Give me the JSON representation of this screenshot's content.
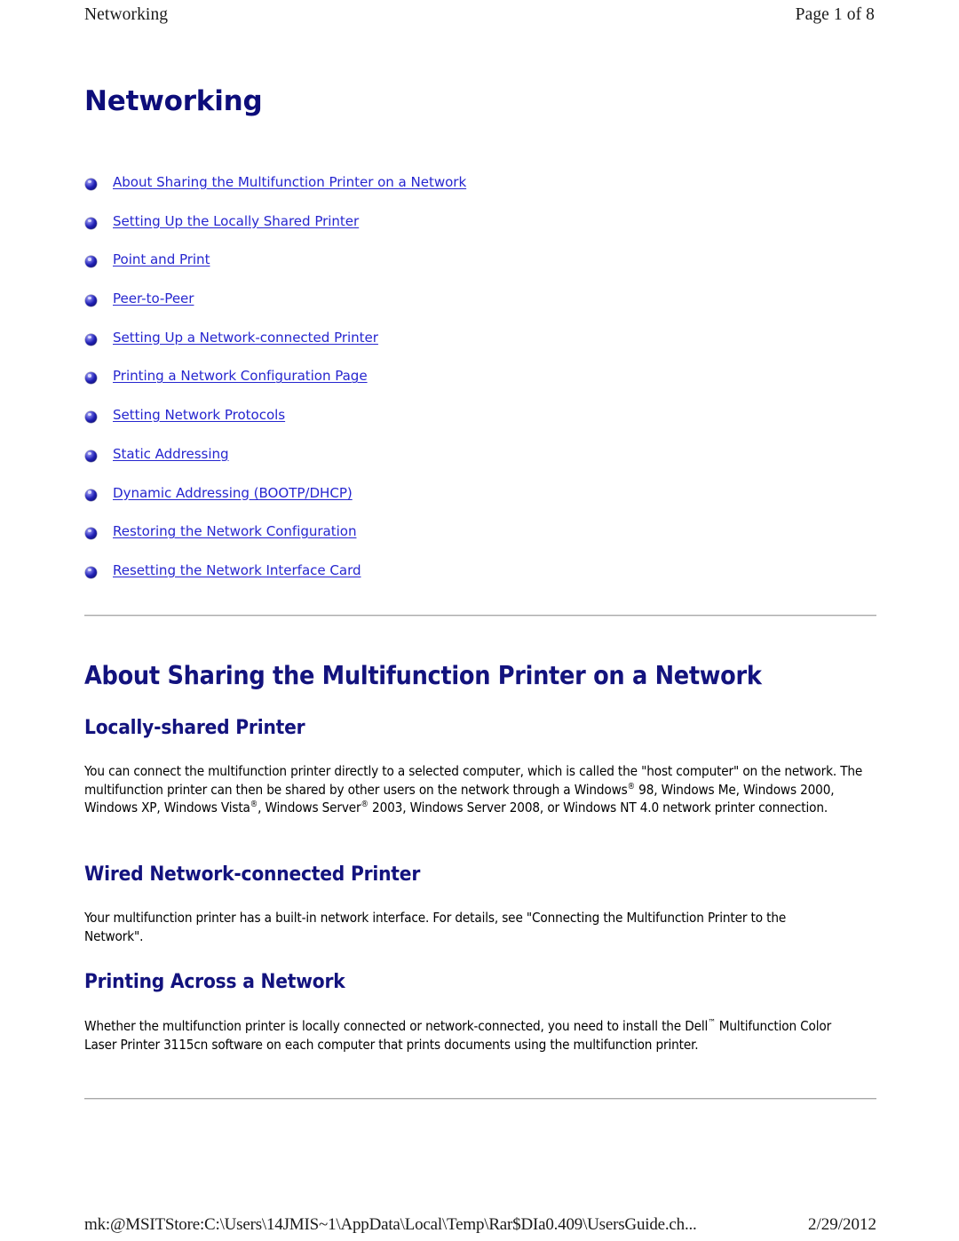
{
  "page_header": {
    "left_text": "Networking",
    "right_text": "Page 1 of 8"
  },
  "document": {
    "title": "Networking"
  },
  "toc": {
    "items": [
      {
        "label": "About Sharing the Multifunction Printer on a Network"
      },
      {
        "label": "Setting Up the Locally Shared Printer"
      },
      {
        "label": "Point and Print"
      },
      {
        "label": "Peer-to-Peer"
      },
      {
        "label": "Setting Up a Network-connected Printer"
      },
      {
        "label": "Printing a Network Configuration Page"
      },
      {
        "label": "Setting Network Protocols"
      },
      {
        "label": "Static Addressing"
      },
      {
        "label": "Dynamic Addressing (BOOTP/DHCP)"
      },
      {
        "label": "Restoring the Network Configuration"
      },
      {
        "label": "Resetting the Network Interface Card"
      }
    ]
  },
  "sections": {
    "about": {
      "heading": "About Sharing the Multifunction Printer on a Network",
      "locally": {
        "heading": "Locally-shared Printer",
        "body_part_1": "You can connect the multifunction printer directly to a selected computer, which is called the \"host computer\" on the network. The multifunction printer can then be shared by other users on the network through a Windows",
        "reg_1": "®",
        "body_part_2": " 98, Windows Me, Windows 2000, Windows XP, Windows Vista",
        "reg_2": "®",
        "body_part_3": ", Windows Server",
        "reg_3": "®",
        "body_part_4": " 2003, Windows Server 2008, or Windows NT 4.0 network printer connection."
      },
      "wired": {
        "heading": "Wired Network-connected Printer",
        "body": "Your multifunction printer has a built-in network interface. For details, see \"Connecting the Multifunction Printer to the Network\"."
      },
      "across": {
        "heading": "Printing Across a Network",
        "body_part_1": "Whether the multifunction printer is locally connected or network-connected, you need to install the Dell",
        "tm": "™",
        "body_part_2": " Multifunction Color Laser Printer 3115cn software on each computer that prints documents using the multifunction printer."
      }
    }
  },
  "page_footer": {
    "path": "mk:@MSITStore:C:\\Users\\14JMIS~1\\AppData\\Local\\Temp\\Rar$DIa0.409\\UsersGuide.ch...",
    "date": "2/29/2012"
  },
  "colors": {
    "heading_navy": "#13137e",
    "link_blue": "#2626cf",
    "rule_gray": "#a8a8a8",
    "bullet_blue": "#2020b4"
  }
}
